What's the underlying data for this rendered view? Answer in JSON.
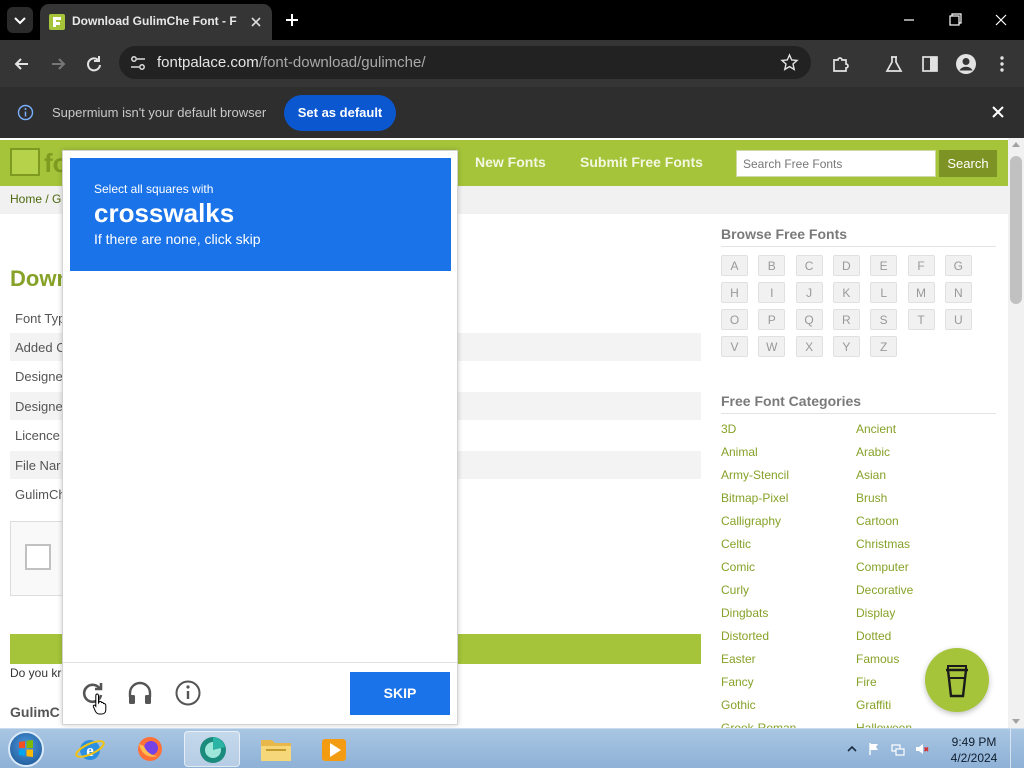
{
  "browser": {
    "tab_title": "Download GulimChe Font - Free Font Download",
    "url_host": "fontpalace.com",
    "url_path": "/font-download/gulimche/",
    "infobar_text": "Supermium isn't your default browser",
    "set_default_label": "Set as default"
  },
  "site": {
    "logo_text": "fo",
    "nav": [
      "New Fonts",
      "Submit Free Fonts"
    ],
    "search_placeholder": "Search Free Fonts",
    "search_button": "Search",
    "breadcrumb": "Home / G",
    "heading": "Down",
    "info_rows": [
      "Font Typ",
      "Added C",
      "Designe",
      "Designe",
      "Licence",
      "File Nar",
      "GulimCh"
    ],
    "do_you_text": "Do you kr",
    "subheading": "GulimC"
  },
  "sidebar": {
    "browse_title": "Browse Free Fonts",
    "letters": [
      "A",
      "B",
      "C",
      "D",
      "E",
      "F",
      "G",
      "H",
      "I",
      "J",
      "K",
      "L",
      "M",
      "N",
      "O",
      "P",
      "Q",
      "R",
      "S",
      "T",
      "U",
      "V",
      "W",
      "X",
      "Y",
      "Z"
    ],
    "categories_title": "Free Font Categories",
    "categories_left": [
      "3D",
      "Animal",
      "Army-Stencil",
      "Bitmap-Pixel",
      "Calligraphy",
      "Celtic",
      "Comic",
      "Curly",
      "Dingbats",
      "Distorted",
      "Easter",
      "Fancy",
      "Gothic",
      "Greek-Roman"
    ],
    "categories_right": [
      "Ancient",
      "Arabic",
      "Asian",
      "Brush",
      "Cartoon",
      "Christmas",
      "Computer",
      "Decorative",
      "Display",
      "Dotted",
      "Famous",
      "Fire",
      "Graffiti",
      "Halloween"
    ]
  },
  "captcha": {
    "line1": "Select all squares with",
    "keyword": "crosswalks",
    "line3": "If there are none, click skip",
    "skip_label": "SKIP",
    "icons": [
      "reload-icon",
      "headphones-icon",
      "info-icon"
    ]
  },
  "taskbar": {
    "time": "9:49 PM",
    "date": "4/2/2024"
  },
  "colors": {
    "brand_green": "#a5c43a",
    "captcha_blue": "#1a73e8",
    "chrome_dark": "#353535"
  }
}
